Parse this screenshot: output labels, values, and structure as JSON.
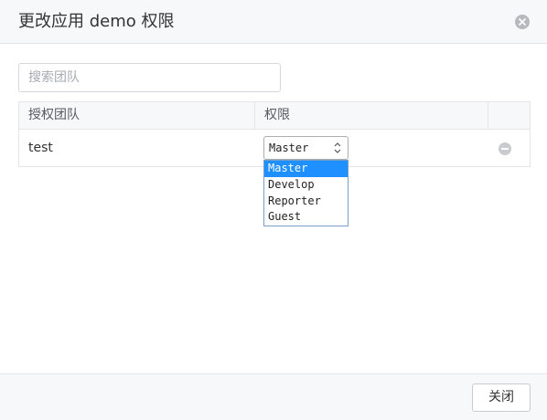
{
  "dialog": {
    "title": "更改应用 demo 权限"
  },
  "search": {
    "placeholder": "搜索团队",
    "value": ""
  },
  "table": {
    "columns": [
      "授权团队",
      "权限",
      ""
    ],
    "rows": [
      {
        "team": "test",
        "permission": "Master"
      }
    ]
  },
  "dropdown": {
    "options": [
      "Master",
      "Develop",
      "Reporter",
      "Guest"
    ],
    "selected": "Master"
  },
  "footer": {
    "close_label": "关闭"
  },
  "colors": {
    "accent": "#1e90ff",
    "header_bg": "#f7f8fa",
    "border": "#e3e5e8"
  }
}
